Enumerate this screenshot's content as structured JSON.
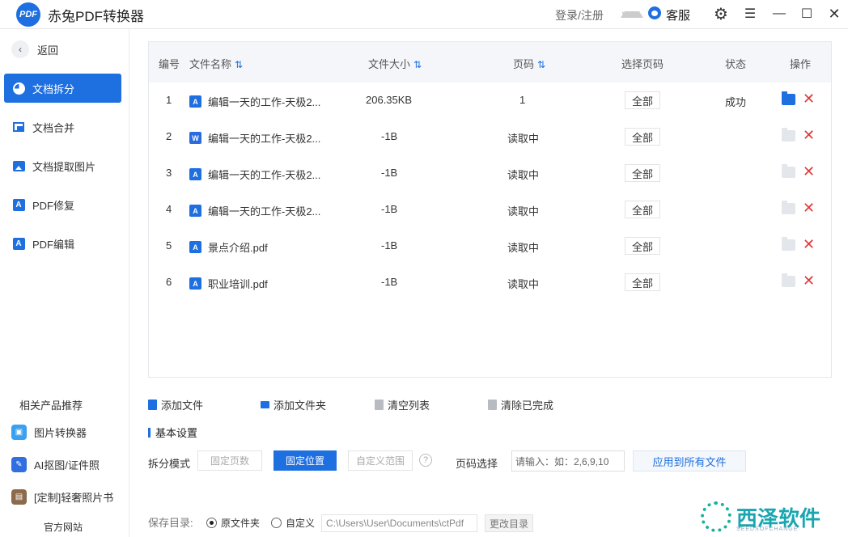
{
  "app": {
    "logo_text": "PDF",
    "title": "赤兔PDF转换器"
  },
  "titlebar": {
    "login_label": "登录/注册",
    "vip_label": "VIP",
    "service_label": "客服",
    "gear_icon": "⚙",
    "menu_icon": "☰",
    "min_icon": "—",
    "max_icon": "☐",
    "close_icon": "✕"
  },
  "sidebar": {
    "back_label": "返回",
    "back_icon": "‹",
    "items": [
      {
        "label": "文档拆分",
        "icon": "pie-icon",
        "active": true
      },
      {
        "label": "文档合并",
        "icon": "merge-icon",
        "active": false
      },
      {
        "label": "文档提取图片",
        "icon": "image-icon",
        "active": false
      },
      {
        "label": "PDF修复",
        "icon": "pdf-icon",
        "active": false
      },
      {
        "label": "PDF编辑",
        "icon": "pdf-icon",
        "active": false
      }
    ],
    "recommend_title": "相关产品推荐",
    "recommend": [
      {
        "label": "图片转换器"
      },
      {
        "label": "AI抠图/证件照"
      },
      {
        "label": "[定制]轻奢照片书"
      }
    ],
    "official_site": "官方网站"
  },
  "table": {
    "headers": {
      "index": "编号",
      "name": "文件名称",
      "size": "文件大小",
      "pages": "页码",
      "select_pages": "选择页码",
      "status": "状态",
      "actions": "操作"
    },
    "sort_icon": "⇅",
    "rows": [
      {
        "index": "1",
        "type": "pdf",
        "name": "编辑一天的工作-天极2...",
        "size": "206.35KB",
        "pages": "1",
        "select": "全部",
        "status": "成功",
        "folder_active": true
      },
      {
        "index": "2",
        "type": "word",
        "name": "编辑一天的工作-天极2...",
        "size": "-1B",
        "pages": "读取中",
        "select": "全部",
        "status": "",
        "folder_active": false
      },
      {
        "index": "3",
        "type": "pdf",
        "name": "编辑一天的工作-天极2...",
        "size": "-1B",
        "pages": "读取中",
        "select": "全部",
        "status": "",
        "folder_active": false
      },
      {
        "index": "4",
        "type": "pdf",
        "name": "编辑一天的工作-天极2...",
        "size": "-1B",
        "pages": "读取中",
        "select": "全部",
        "status": "",
        "folder_active": false
      },
      {
        "index": "5",
        "type": "pdf",
        "name": "景点介绍.pdf",
        "size": "-1B",
        "pages": "读取中",
        "select": "全部",
        "status": "",
        "folder_active": false
      },
      {
        "index": "6",
        "type": "pdf",
        "name": "职业培训.pdf",
        "size": "-1B",
        "pages": "读取中",
        "select": "全部",
        "status": "",
        "folder_active": false
      }
    ],
    "delete_icon": "✕"
  },
  "toolbar": {
    "add_file": "添加文件",
    "add_folder": "添加文件夹",
    "clear_list": "清空列表",
    "clear_done": "清除已完成"
  },
  "settings": {
    "title": "基本设置",
    "split_mode_label": "拆分模式",
    "modes": [
      "固定页数",
      "固定位置",
      "自定义范围"
    ],
    "active_mode": "固定位置",
    "help_icon": "?",
    "page_select_label": "页码选择",
    "page_input_placeholder": "请输入：如：2,6,9,10",
    "apply_all": "应用到所有文件"
  },
  "save": {
    "label": "保存目录:",
    "option_original": "原文件夹",
    "option_custom": "自定义",
    "selected": "原文件夹",
    "path": "C:\\Users\\User\\Documents\\ctPdf",
    "change_btn": "更改目录"
  },
  "watermark": {
    "text": "西泽软件",
    "sub": "SEEDSOFCHANGE"
  },
  "colors": {
    "accent": "#1e6fe0",
    "danger": "#e03a3a"
  }
}
